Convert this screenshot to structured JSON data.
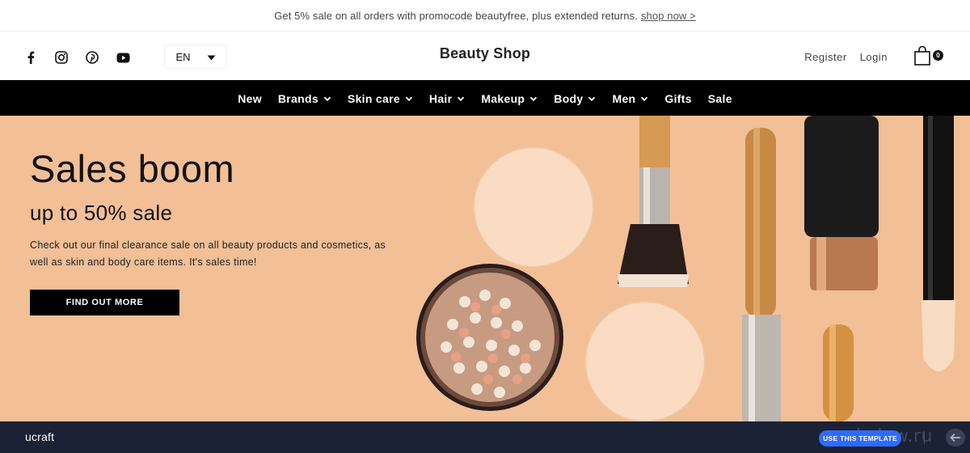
{
  "announcement": {
    "text": "Get 5% sale on all orders with promocode beautyfree, plus extended returns.",
    "link": "shop now >"
  },
  "header": {
    "brand": "Beauty Shop",
    "language": "EN",
    "register": "Register",
    "login": "Login",
    "cart_count": "0",
    "social_icons": [
      "facebook-icon",
      "instagram-icon",
      "pinterest-icon",
      "youtube-icon"
    ]
  },
  "nav": {
    "items": [
      {
        "label": "New",
        "dropdown": false
      },
      {
        "label": "Brands",
        "dropdown": true
      },
      {
        "label": "Skin care",
        "dropdown": true
      },
      {
        "label": "Hair",
        "dropdown": true
      },
      {
        "label": "Makeup",
        "dropdown": true
      },
      {
        "label": "Body",
        "dropdown": true
      },
      {
        "label": "Men",
        "dropdown": true
      },
      {
        "label": "Gifts",
        "dropdown": false
      },
      {
        "label": "Sale",
        "dropdown": false
      }
    ]
  },
  "hero": {
    "title": "Sales boom",
    "subtitle": "up to 50% sale",
    "description": "Check out our final clearance sale on all beauty products and cosmetics, as well as skin and body care items. It's sales time!",
    "cta": "FIND OUT MORE",
    "background_color": "#f2bf97"
  },
  "bottom_bar": {
    "logo": "ucraft",
    "use_template": "USE THIS TEMPLATE",
    "watermark": "grizdew.ru",
    "accent_color": "#2f6bff"
  }
}
